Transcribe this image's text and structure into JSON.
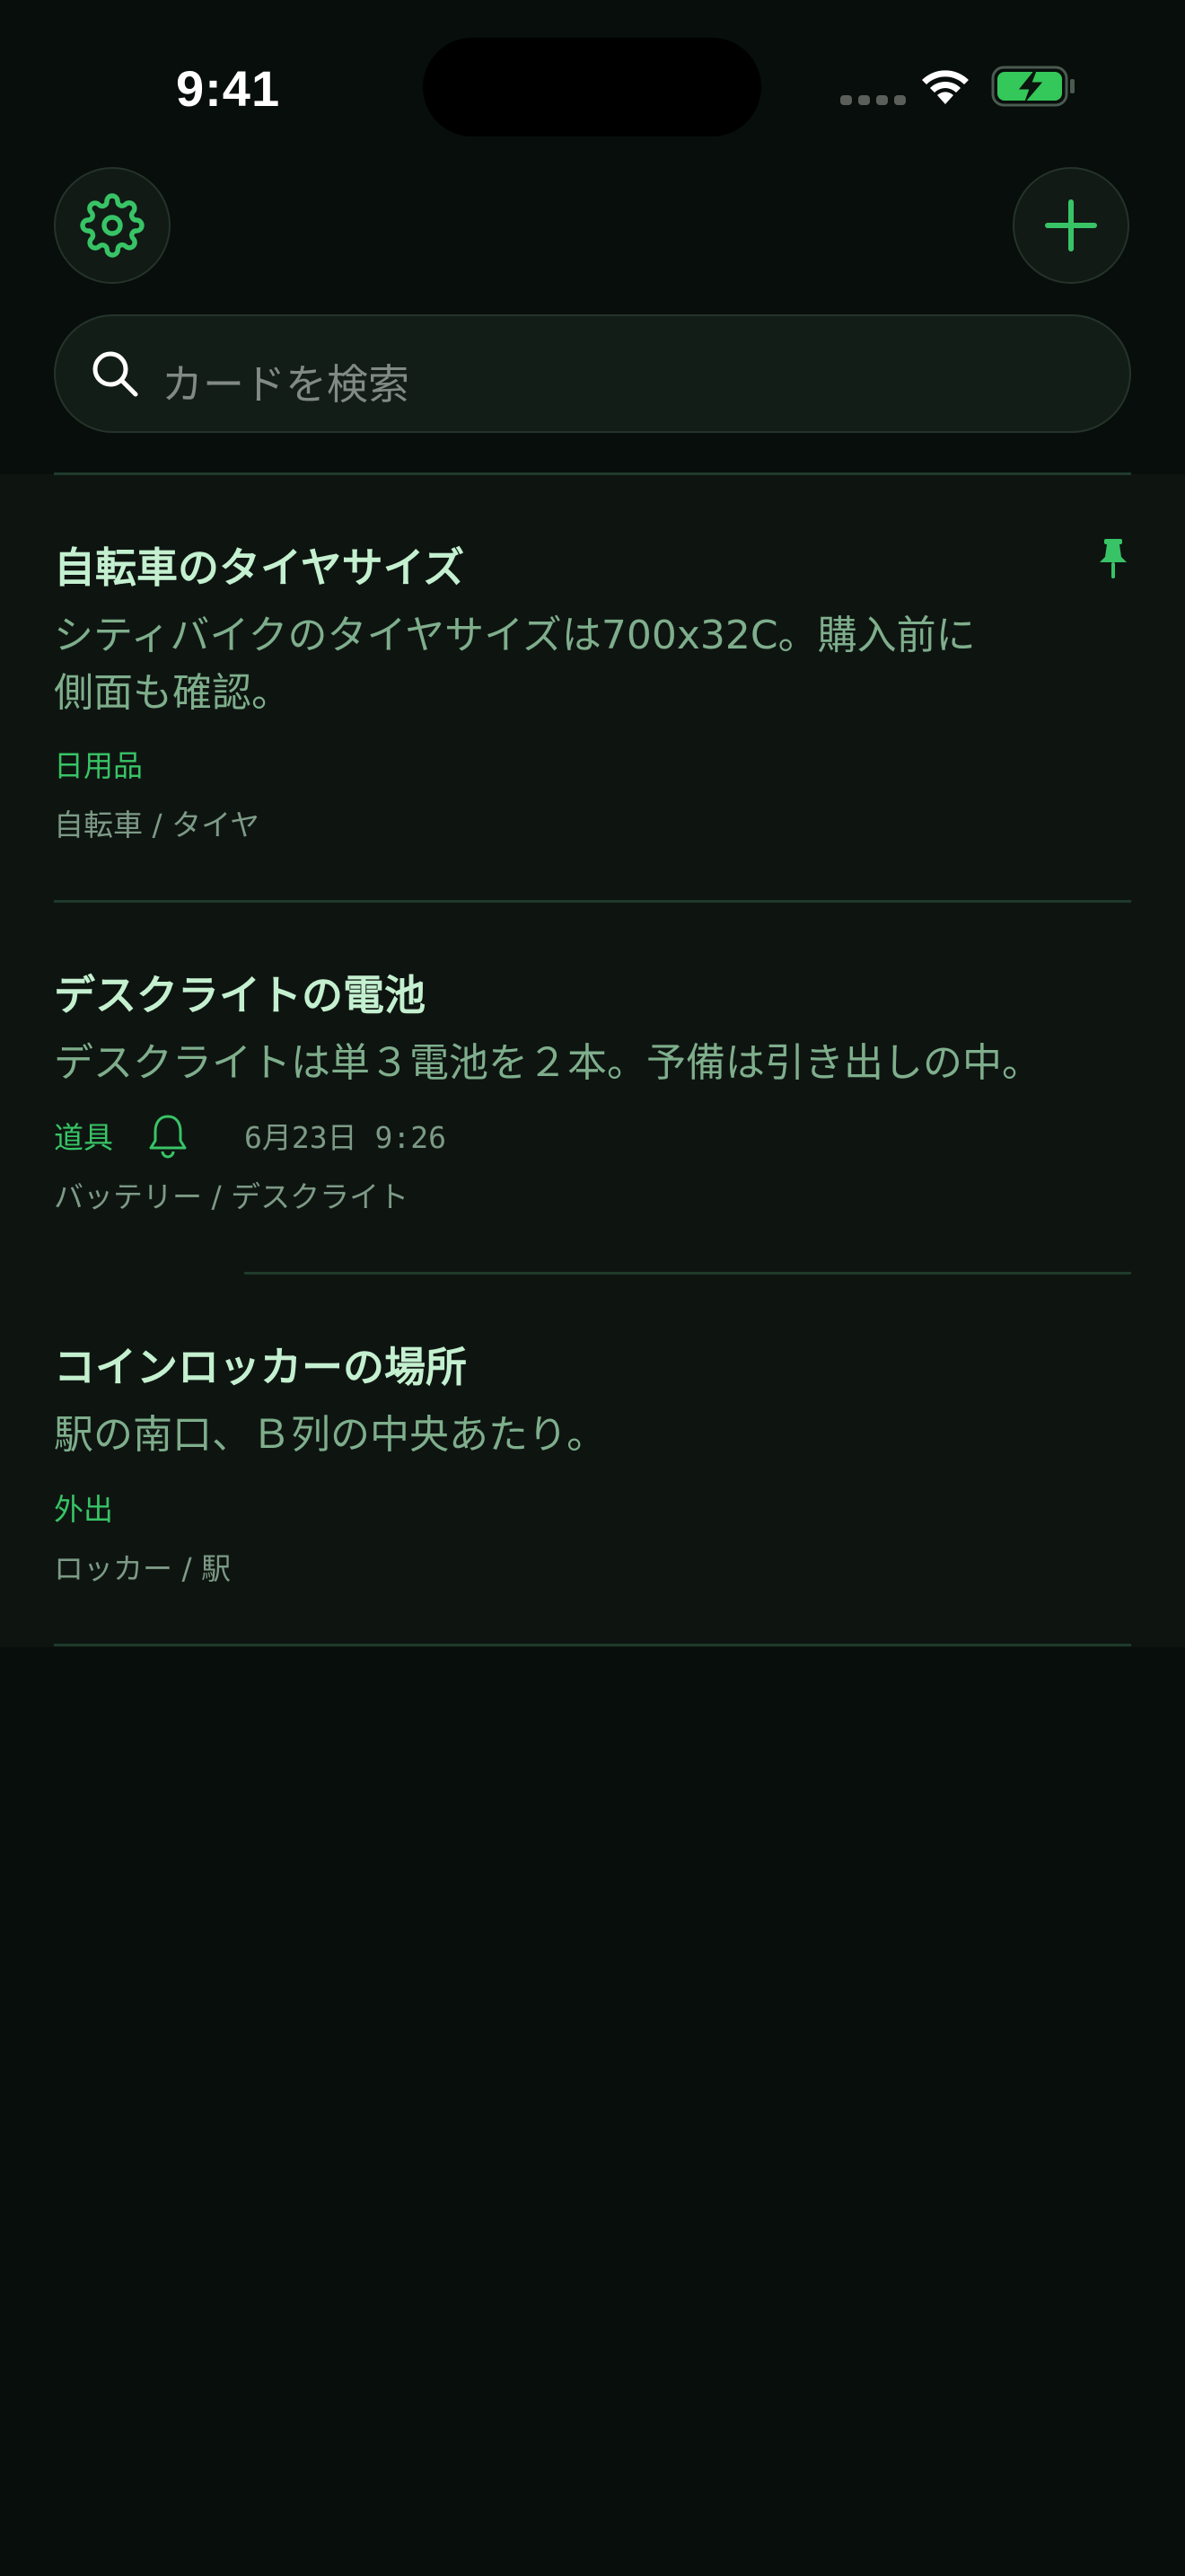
{
  "status_bar": {
    "time": "9:41"
  },
  "header": {
    "settings_icon": "gear-icon",
    "add_icon": "plus-icon"
  },
  "search": {
    "placeholder": "カードを検索"
  },
  "cards": [
    {
      "title": "自転車のタイヤサイズ",
      "body": "シティバイクのタイヤサイズは700x32C。購入前に\n側面も確認。",
      "category": "日用品",
      "tags": "自転車 / タイヤ",
      "pinned": true
    },
    {
      "title": "デスクライトの電池",
      "body": "デスクライトは単３電池を２本。予備は引き出しの中。",
      "category": "道具",
      "reminder": "6月23日 9:26",
      "tags": "バッテリー / デスクライト",
      "pinned": false
    },
    {
      "title": "コインロッカーの場所",
      "body": "駅の南口、Ｂ列の中央あたり。",
      "category": "外出",
      "tags": "ロッカー / 駅",
      "pinned": false
    }
  ],
  "colors": {
    "background": "#080e0b",
    "panel": "#0e1511",
    "accent": "#38c466",
    "title": "#c4f0d0",
    "body": "#7fae8c",
    "divider": "#1f3a2a"
  }
}
